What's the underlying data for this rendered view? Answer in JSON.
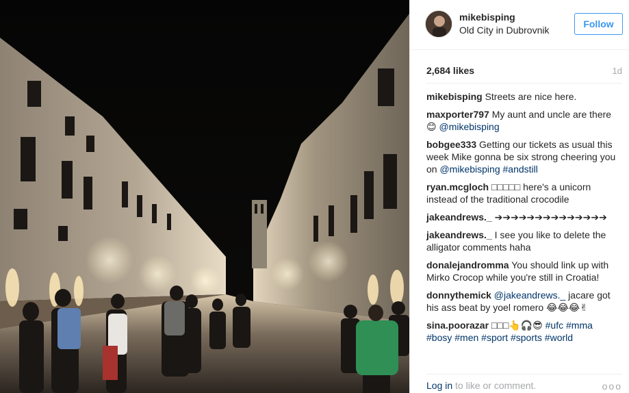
{
  "post": {
    "username": "mikebisping",
    "location": "Old City in Dubrovnik",
    "follow_label": "Follow",
    "likes": "2,684 likes",
    "age": "1d"
  },
  "comments": [
    {
      "author": "mikebisping",
      "text": "Streets are nice here."
    },
    {
      "author": "maxporter797",
      "text": "My aunt and uncle are there 😊 ",
      "mention": "@mikebisping"
    },
    {
      "author": "bobgee333",
      "text": "Getting our tickets as usual this week Mike gonna be six strong cheering you on ",
      "mention": "@mikebisping",
      "hashtag": "#andstill"
    },
    {
      "author": "ryan.mcgloch",
      "text": "□□□□□ here's a unicorn instead of the traditional crocodile"
    },
    {
      "author": "jakeandrews._",
      "text": "➔➔➔➔➔➔➔➔➔➔➔➔➔➔"
    },
    {
      "author": "jakeandrews._",
      "text": "I see you like to delete the alligator comments haha"
    },
    {
      "author": "donalejandromma",
      "text": "You should link up with Mirko Crocop while you're still in Croatia!"
    },
    {
      "author": "donnythemick",
      "mention": "@jakeandrews._",
      "text": " jacare got his ass beat by yoel romero 😂😂😂✌"
    },
    {
      "author": "sina.poorazar",
      "text": "□□□👆🎧😎 ",
      "hashtags": [
        "#ufc",
        "#mma",
        "#bosy",
        "#men",
        "#sport",
        "#sports",
        "#world"
      ]
    }
  ],
  "footer": {
    "login_link": "Log in",
    "login_rest": " to like or comment.",
    "more_label": "ooo"
  },
  "colors": {
    "accent": "#3897f0",
    "link": "#003569",
    "muted": "#a5a7aa"
  }
}
